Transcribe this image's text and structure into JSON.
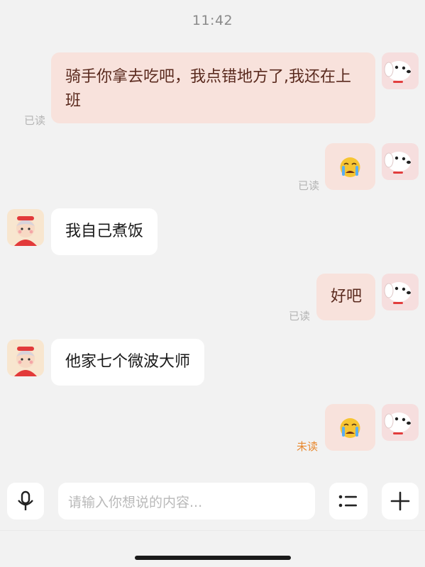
{
  "header": {
    "time": "11:42"
  },
  "messages": [
    {
      "side": "out",
      "text": "骑手你拿去吃吧，我点错地方了,我还在上班",
      "status": "已读"
    },
    {
      "side": "out",
      "emoji": "crying-face-emoji",
      "status": "已读"
    },
    {
      "side": "in",
      "text": "我自己煮饭"
    },
    {
      "side": "out",
      "text": "好吧",
      "status": "已读"
    },
    {
      "side": "in",
      "text": "他家七个微波大师"
    },
    {
      "side": "out",
      "emoji": "crying-face-emoji",
      "status": "未读"
    }
  ],
  "composer": {
    "voice_icon": "microphone-icon",
    "placeholder": "请输入你想说的内容...",
    "list_icon": "list-icon",
    "plus_icon": "plus-icon"
  },
  "colors": {
    "background": "#f2f2f2",
    "outgoing_bubble": "#f8e2dc",
    "incoming_bubble": "#ffffff",
    "unread_status": "#e8882e"
  }
}
